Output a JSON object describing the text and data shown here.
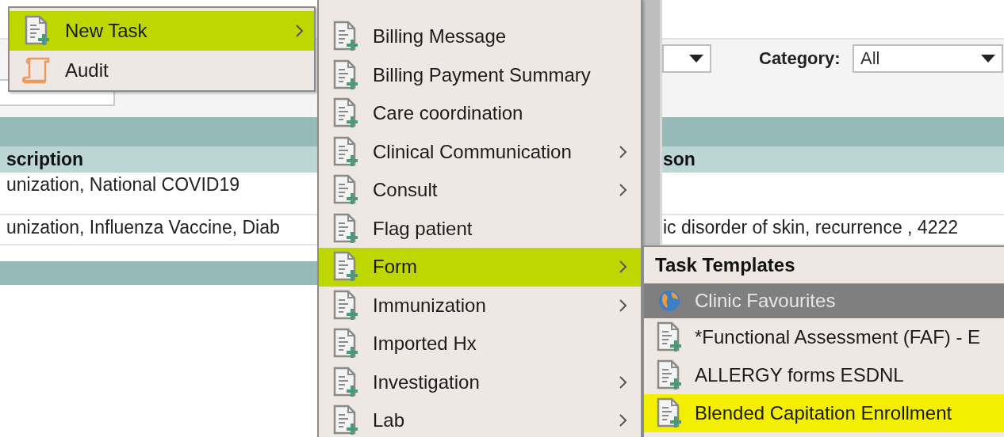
{
  "filter_bar": {
    "dropdown": {
      "kind": "select"
    },
    "category": {
      "label": "Category:",
      "value": "All"
    }
  },
  "table": {
    "columns": [
      "scription",
      "son"
    ],
    "rows": [
      {
        "column_1": "unization, National COVID19"
      },
      {
        "column_1": "unization, Influenza Vaccine, Diab",
        "column_2": "ic disorder of skin, recurrence , 4222"
      }
    ]
  },
  "context_menu": {
    "items": [
      {
        "label": "New Task",
        "kind": "task",
        "has_submenu": true,
        "selected": true
      },
      {
        "label": "Audit",
        "kind": "audit",
        "has_submenu": false,
        "selected": false
      }
    ]
  },
  "task_submenu": {
    "items": [
      {
        "label": "Billing Message",
        "has_submenu": false,
        "selected": false
      },
      {
        "label": "Billing Payment Summary",
        "has_submenu": false,
        "selected": false
      },
      {
        "label": "Care coordination",
        "has_submenu": false,
        "selected": false
      },
      {
        "label": "Clinical Communication",
        "has_submenu": true,
        "selected": false
      },
      {
        "label": "Consult",
        "has_submenu": true,
        "selected": false
      },
      {
        "label": "Flag patient",
        "has_submenu": false,
        "selected": false
      },
      {
        "label": "Form",
        "has_submenu": true,
        "selected": true
      },
      {
        "label": "Immunization",
        "has_submenu": true,
        "selected": false
      },
      {
        "label": "Imported Hx",
        "has_submenu": false,
        "selected": false
      },
      {
        "label": "Investigation",
        "has_submenu": true,
        "selected": false
      },
      {
        "label": "Lab",
        "has_submenu": true,
        "selected": false
      }
    ]
  },
  "templates_menu": {
    "title": "Task Templates",
    "items": [
      {
        "label": "Clinic Favourites",
        "kind": "group",
        "selected": false
      },
      {
        "label": "*Functional Assessment (FAF) - E",
        "kind": "template",
        "selected": false
      },
      {
        "label": "ALLERGY forms ESDNL",
        "kind": "template",
        "selected": false
      },
      {
        "label": "Blended Capitation Enrollment",
        "kind": "template",
        "selected": true
      }
    ]
  }
}
